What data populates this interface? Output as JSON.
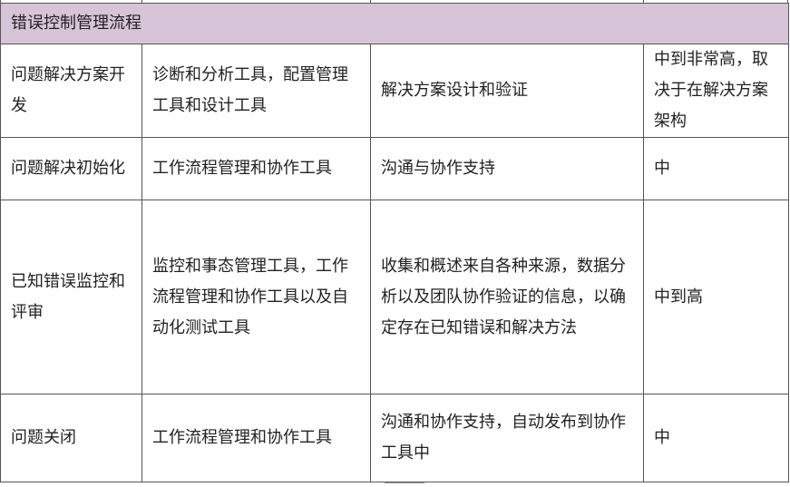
{
  "table": {
    "title": "错误控制管理流程",
    "rows": [
      {
        "phase": "问题解决方案开发",
        "tools": "诊断和分析工具，配置管理工具和设计工具",
        "activity": "解决方案设计和验证",
        "level": "中到非常高，取决于在解决方案架构"
      },
      {
        "phase": "问题解决初始化",
        "tools": "工作流程管理和协作工具",
        "activity": "沟通与协作支持",
        "level": "中"
      },
      {
        "phase": "已知错误监控和评审",
        "tools": "监控和事态管理工具，工作流程管理和协作工具以及自动化测试工具",
        "activity": "收集和概述来自各种来源，数据分析以及团队协作验证的信息，以确定存在已知错误和解决方法",
        "level": "中到高"
      },
      {
        "phase": "问题关闭",
        "tools": "工作流程管理和协作工具",
        "activity": "沟通和协作支持，自动发布到协作工具中",
        "level": "中"
      }
    ]
  }
}
